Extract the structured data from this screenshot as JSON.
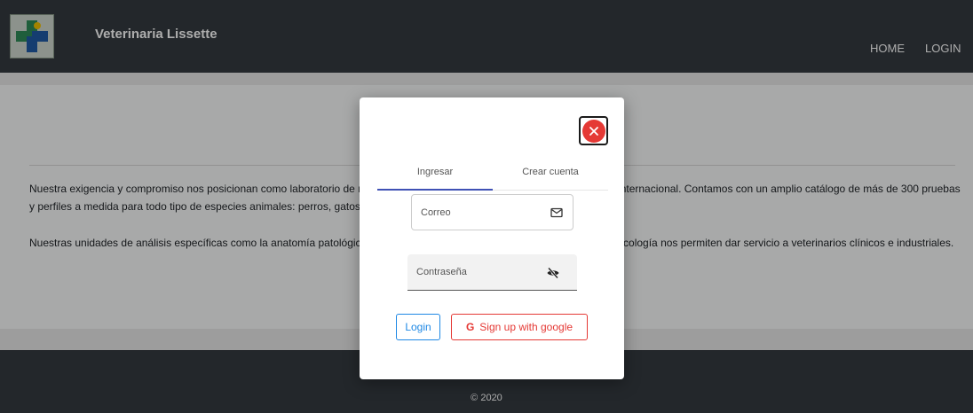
{
  "header": {
    "brand": "Veterinaria Lissette",
    "nav": {
      "home": "HOME",
      "login": "LOGIN"
    }
  },
  "content": {
    "paragraph_1": "Nuestra exigencia y compromiso nos posicionan como laboratorio de referencia en diagnóstico veterinario a nivel nacional e internacional. Contamos con un amplio catálogo de más de 300 pruebas y perfiles a medida para todo tipo de especies animales: perros, gatos, caballos, animales exóticos y de granja.",
    "paragraph_2": "Nuestras unidades de análisis específicas como la anatomía patológica, microbiología, parasitología, biología molecular y toxicología nos permiten dar servicio a veterinarios clínicos e industriales."
  },
  "footer": {
    "copyright": "© 2020"
  },
  "modal": {
    "tabs": {
      "login": "Ingresar",
      "signup": "Crear cuenta"
    },
    "email": {
      "placeholder": "Correo",
      "value": ""
    },
    "password": {
      "placeholder": "Contraseña",
      "value": ""
    },
    "login_button": "Login",
    "google_button": "Sign up with google",
    "google_glyph": "G",
    "icons": {
      "close": "close-icon",
      "email": "mail-icon",
      "password": "eye-off-icon",
      "google": "google-icon"
    }
  },
  "colors": {
    "navbar": "#343a40",
    "accent_tab": "#3f51b5",
    "login_button": "#1e88e5",
    "google_button": "#e53935",
    "close_button": "#e53935"
  }
}
